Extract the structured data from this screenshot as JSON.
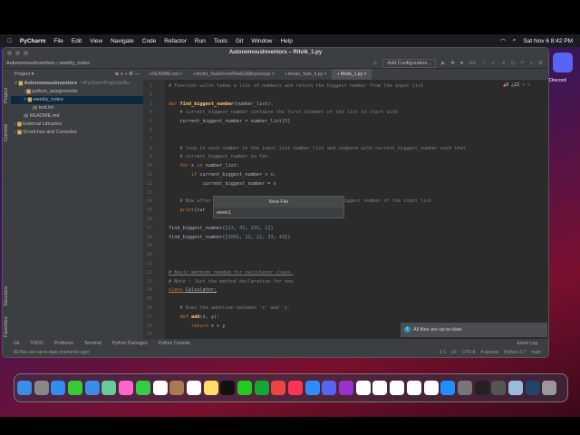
{
  "menubar": {
    "app": "PyCharm",
    "items": [
      "File",
      "Edit",
      "View",
      "Navigate",
      "Code",
      "Refactor",
      "Run",
      "Tools",
      "Git",
      "Window",
      "Help"
    ],
    "clock": "Sat Nov 6  8:42 PM"
  },
  "window": {
    "title": "AutonomousInventors – Ritvik_1.py",
    "breadcrumb": [
      "AutonomousInventors",
      "weekly_notes"
    ],
    "add_config": "Add Configuration...",
    "git_label": "Git:"
  },
  "project": {
    "header": "Project",
    "tree": [
      {
        "label": "AutonomousInventors",
        "extra": "~/PycharmProjects/Au",
        "depth": 0,
        "type": "folder",
        "open": true
      },
      {
        "label": "python_assignments",
        "depth": 1,
        "type": "folder"
      },
      {
        "label": "weekly_notes",
        "depth": 1,
        "type": "folder",
        "open": true,
        "selected": true
      },
      {
        "label": "test.txt",
        "depth": 2,
        "type": "file"
      },
      {
        "label": "README.md",
        "depth": 1,
        "type": "file"
      },
      {
        "label": "External Libraries",
        "depth": 0,
        "type": "lib"
      },
      {
        "label": "Scratches and Consoles",
        "depth": 0,
        "type": "lib"
      }
    ]
  },
  "side_tabs": [
    "Project",
    "Commit",
    "Structure",
    "Favorites"
  ],
  "tabs": [
    {
      "label": "README.md"
    },
    {
      "label": "Archit_TasksFromWeek2&Beyond.py"
    },
    {
      "label": "Arnav_Task_4.py"
    },
    {
      "label": "Ritvik_1.py",
      "active": true
    }
  ],
  "inspections": {
    "warnings": "6",
    "weak": "22"
  },
  "code": [
    [
      [
        "# Function witch takes a list of numbers and return the biggest number from the input list",
        "cm"
      ]
    ],
    [],
    [
      [
        "def ",
        "kw"
      ],
      [
        "find_biggest_number",
        "fn"
      ],
      [
        "(number_list):",
        ""
      ]
    ],
    [
      [
        "    # current_biggest_number contains the first element of the list to start with",
        "cm"
      ]
    ],
    [
      [
        "    current_biggest_number = number_list[",
        ""
      ],
      [
        "0",
        "nm"
      ],
      [
        "]",
        ""
      ]
    ],
    [],
    [],
    [
      [
        "    # loop to each number in the input list number_list and compare with current_biggest_number such that",
        "cm"
      ]
    ],
    [
      [
        "    # current_biggest_number so far.",
        "cm"
      ]
    ],
    [
      [
        "    for ",
        "kw"
      ],
      [
        "x ",
        ""
      ],
      [
        "in ",
        "kw"
      ],
      [
        "number_list:",
        ""
      ]
    ],
    [
      [
        "        if ",
        "kw"
      ],
      [
        "current_biggest_number < x:",
        ""
      ]
    ],
    [
      [
        "            current_biggest_number = x",
        ""
      ]
    ],
    [],
    [
      [
        "    # Now after the loop current_biggest_number contains the biggest number of the input list",
        "cm"
      ]
    ],
    [
      [
        "    print",
        "kw"
      ],
      [
        "(cur",
        ""
      ]
    ],
    [],
    [
      [
        "find_biggest_number([",
        ""
      ],
      [
        "23",
        "nm"
      ],
      [
        ", ",
        ""
      ],
      [
        "43",
        "nm"
      ],
      [
        ", ",
        ""
      ],
      [
        "233",
        "nm"
      ],
      [
        ", ",
        ""
      ],
      [
        "1",
        "nm"
      ],
      [
        "])",
        ""
      ]
    ],
    [
      [
        "find_biggest_number([",
        ""
      ],
      [
        "1001",
        "nm"
      ],
      [
        ", ",
        ""
      ],
      [
        "12",
        "nm"
      ],
      [
        ", ",
        ""
      ],
      [
        "22",
        "nm"
      ],
      [
        ", ",
        ""
      ],
      [
        "33",
        "nm"
      ],
      [
        ", ",
        ""
      ],
      [
        "43",
        "nm"
      ],
      [
        "])",
        ""
      ]
    ],
    [],
    [],
    [],
    [
      [
        "# Basic methods needed for calculator class.",
        "cm ul"
      ]
    ],
    [
      [
        "# Note : Just the method declaration for now",
        "cm"
      ]
    ],
    [
      [
        "class ",
        "kw ul"
      ],
      [
        "Calculator:",
        "ul"
      ]
    ],
    [],
    [
      [
        "    # Does the addition between 'x' and 'y'",
        "cm"
      ]
    ],
    [
      [
        "    def ",
        "kw"
      ],
      [
        "add",
        "fn"
      ],
      [
        "(x, y):",
        ""
      ]
    ],
    [
      [
        "        return ",
        "kw"
      ],
      [
        "x + y",
        ""
      ]
    ],
    []
  ],
  "popup": {
    "title": "New File",
    "value": "week1"
  },
  "notification": "All files are up-to-date",
  "toolwindows": [
    "Git",
    "TODO",
    "Problems",
    "Terminal",
    "Python Packages",
    "Python Console"
  ],
  "event_log": "Event Log",
  "status": {
    "message": "All files are up-to-date (moments ago)",
    "items": [
      "1:1",
      "LF",
      "UTF-8",
      "4 spaces",
      "Python 2.7",
      "main"
    ]
  },
  "desktop": {
    "discord_label": "Discord"
  },
  "dock": [
    {
      "name": "finder",
      "color": "#3a8ee6"
    },
    {
      "name": "launchpad",
      "color": "#888"
    },
    {
      "name": "safari",
      "color": "#2f8ef0"
    },
    {
      "name": "messages",
      "color": "#3c3"
    },
    {
      "name": "mail",
      "color": "#3a8ee6"
    },
    {
      "name": "maps",
      "color": "#6c9"
    },
    {
      "name": "photos",
      "color": "#f6c"
    },
    {
      "name": "facetime",
      "color": "#3c4"
    },
    {
      "name": "calendar",
      "color": "#fff"
    },
    {
      "name": "contacts",
      "color": "#a87b4f"
    },
    {
      "name": "reminders",
      "color": "#fff"
    },
    {
      "name": "notes",
      "color": "#fd6"
    },
    {
      "name": "tv",
      "color": "#111"
    },
    {
      "name": "pycharm",
      "color": "#2c2"
    },
    {
      "name": "hangouts",
      "color": "#1a3"
    },
    {
      "name": "chrome",
      "color": "#e44"
    },
    {
      "name": "music",
      "color": "#f35"
    },
    {
      "name": "zoom",
      "color": "#2d8cff"
    },
    {
      "name": "discord",
      "color": "#5865f2"
    },
    {
      "name": "podcasts",
      "color": "#93c"
    },
    {
      "name": "news",
      "color": "#fff"
    },
    {
      "name": "slack",
      "color": "#fff"
    },
    {
      "name": "keynote",
      "color": "#fff"
    },
    {
      "name": "numbers",
      "color": "#fff"
    },
    {
      "name": "pages",
      "color": "#fff"
    },
    {
      "name": "app-store",
      "color": "#1e90ff"
    },
    {
      "name": "system-preferences",
      "color": "#777"
    },
    {
      "name": "terminal",
      "color": "#222"
    },
    {
      "name": "automator",
      "color": "#555"
    },
    {
      "name": "preview",
      "color": "#9bd"
    },
    {
      "name": "quicktime",
      "color": "#246"
    },
    {
      "name": "trash",
      "color": "#999"
    }
  ]
}
